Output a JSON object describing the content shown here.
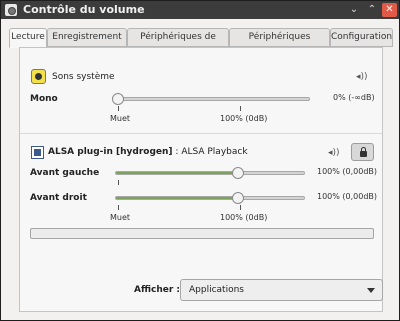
{
  "window": {
    "title": "Contrôle du volume",
    "controls": {
      "minimize": "⌄",
      "maximize": "⌃",
      "close": "✕"
    }
  },
  "tabs": [
    {
      "label": "Lecture",
      "active": true
    },
    {
      "label": "Enregistrement",
      "active": false
    },
    {
      "label": "Périphériques de sortie",
      "active": false
    },
    {
      "label": "Périphériques d'entrée",
      "active": false
    },
    {
      "label": "Configuration",
      "active": false
    }
  ],
  "system_sounds": {
    "title": "Sons système",
    "channel_label": "Mono",
    "value_text": "0% (-∞dB)",
    "level": 0,
    "scale_muted": "Muet",
    "scale_100": "100% (0dB)"
  },
  "stream": {
    "app_name": "ALSA plug-in [hydrogen]",
    "separator": " : ",
    "stream_name": "ALSA Playback",
    "channels": [
      {
        "label": "Avant gauche",
        "value_text": "100% (0,00dB)",
        "level": 100
      },
      {
        "label": "Avant droit",
        "value_text": "100% (0,00dB)",
        "level": 100
      }
    ],
    "scale_muted": "Muet",
    "scale_100": "100% (0dB)",
    "peak_level": 0
  },
  "footer": {
    "show_label": "Afficher :",
    "show_value": "Applications"
  },
  "icons": {
    "speaker": "🔊︎",
    "speaker_glyph": "◂))"
  },
  "colors": {
    "titlebar": "#3c3c3c",
    "slider_fill": "#7da35a",
    "close_button": "#e05a47"
  }
}
